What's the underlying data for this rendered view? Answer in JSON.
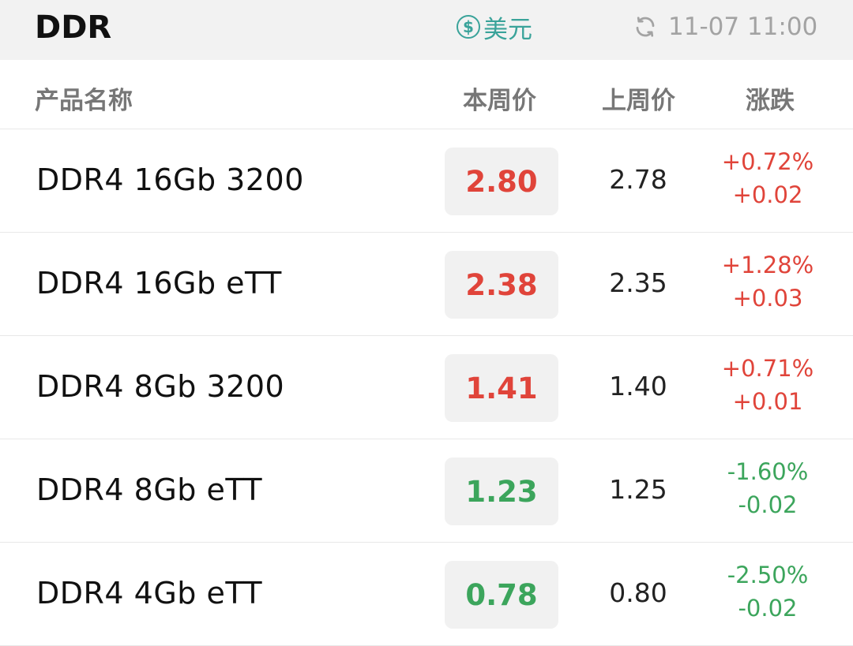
{
  "header": {
    "title": "DDR",
    "currency_label": "美元",
    "currency_icon": "dollar-circle-icon",
    "timestamp": "11-07 11:00",
    "refresh_icon": "refresh-icon"
  },
  "columns": {
    "name": "产品名称",
    "this_week": "本周价",
    "last_week": "上周价",
    "change": "涨跌"
  },
  "colors": {
    "up": "#e0443a",
    "down": "#3ca55c",
    "accent": "#3aa39a"
  },
  "rows": [
    {
      "name": "DDR4 16Gb 3200",
      "this_week": "2.80",
      "last_week": "2.78",
      "change_pct": "+0.72%",
      "change_abs": "+0.02",
      "direction": "up"
    },
    {
      "name": "DDR4 16Gb eTT",
      "this_week": "2.38",
      "last_week": "2.35",
      "change_pct": "+1.28%",
      "change_abs": "+0.03",
      "direction": "up"
    },
    {
      "name": "DDR4 8Gb 3200",
      "this_week": "1.41",
      "last_week": "1.40",
      "change_pct": "+0.71%",
      "change_abs": "+0.01",
      "direction": "up"
    },
    {
      "name": "DDR4 8Gb eTT",
      "this_week": "1.23",
      "last_week": "1.25",
      "change_pct": "-1.60%",
      "change_abs": "-0.02",
      "direction": "down"
    },
    {
      "name": "DDR4 4Gb eTT",
      "this_week": "0.78",
      "last_week": "0.80",
      "change_pct": "-2.50%",
      "change_abs": "-0.02",
      "direction": "down"
    }
  ]
}
